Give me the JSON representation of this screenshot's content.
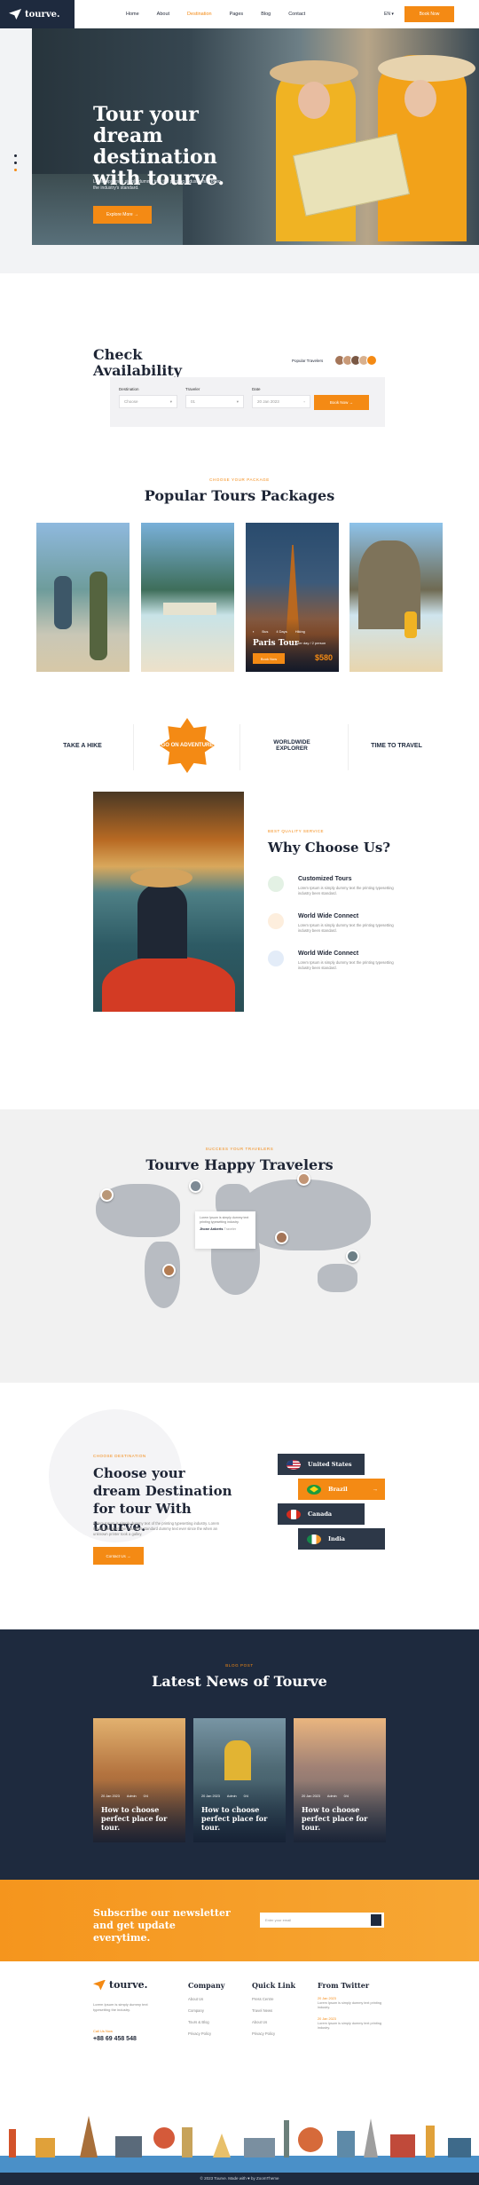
{
  "header": {
    "logo": "tourve.",
    "nav": [
      "Home",
      "About",
      "Destination",
      "Pages",
      "Blog",
      "Contact"
    ],
    "active_nav": "Destination",
    "language": "EN",
    "button": "Book Now"
  },
  "hero": {
    "title": "Tour your dream destination with tourve.",
    "text": "Lorem Ipsum is simply dummy text the printing industry has been the industry's standard.",
    "button": "Explore More"
  },
  "availability": {
    "title": "Check Availability",
    "popular_label": "Popular Travelers",
    "fields": [
      {
        "label": "Destination",
        "value": "Choose"
      },
      {
        "label": "Traveler",
        "value": "01"
      },
      {
        "label": "Date",
        "value": "20 Jan 2023"
      }
    ],
    "button": "Book Now"
  },
  "tours": {
    "subtitle": "CHOOSE YOUR PACKAGE",
    "title": "Popular Tours Packages",
    "featured": {
      "meta": [
        "Bus",
        "4 Days",
        "Hiking"
      ],
      "name": "Paris Tour",
      "duration": "per day / 2 person",
      "button": "Book Now",
      "price": "$580"
    }
  },
  "badges": [
    {
      "text": "TAKE A HIKE",
      "color": "#1e2a3e"
    },
    {
      "text": "GO ON ADVENTURE",
      "color": "#f48a14"
    },
    {
      "text": "WORLDWIDE EXPLORER",
      "color": "#1e2a3e"
    },
    {
      "text": "TIME TO TRAVEL",
      "color": "#1e2a3e"
    }
  ],
  "why": {
    "subtitle": "BEST QUALITY SERVICE",
    "title": "Why Choose Us?",
    "features": [
      {
        "title": "Customized Tours",
        "text": "Lorem Ipsum is simply dummy text the printing typesetting industry been standard.",
        "color": "#e3f1e4"
      },
      {
        "title": "World Wide Connect",
        "text": "Lorem Ipsum is simply dummy text the printing typesetting industry been standard.",
        "color": "#fdeedd"
      },
      {
        "title": "World Wide Connect",
        "text": "Lorem Ipsum is simply dummy text the printing typesetting industry been standard.",
        "color": "#e3ecf8"
      }
    ]
  },
  "travelers": {
    "subtitle": "SUCCESS YOUR TRAVELERS",
    "title": "Tourve Happy Travelers",
    "quote": "Lorem Ipsum is simply dummy text printing typesetting industry.",
    "author": "Jhone Anberts",
    "role": "Traveler"
  },
  "destination": {
    "subtitle": "CHOOSE DESTINATION",
    "title": "Choose your dream Destination for tour With tourve.",
    "text": "Lorem Ipsum is simply dummy text of the printing typesetting industry. Lorem Ipsum has been the industry's standard dummy text ever since the when an unknown printer took a galley.",
    "button": "Contact Us",
    "countries": [
      "United States",
      "Brazil",
      "Canada",
      "India"
    ],
    "active_country": "Brazil"
  },
  "news": {
    "subtitle": "BLOG POST",
    "title": "Latest News of Tourve",
    "posts": [
      {
        "date": "20 Jan 2023",
        "meta": "Admin",
        "comments": "0/4",
        "title": "How to choose perfect place for tour."
      },
      {
        "date": "20 Jan 2023",
        "meta": "Admin",
        "comments": "0/4",
        "title": "How to choose perfect place for tour."
      },
      {
        "date": "20 Jan 2023",
        "meta": "Admin",
        "comments": "0/4",
        "title": "How to choose perfect place for tour."
      }
    ]
  },
  "newsletter": {
    "title": "Subscribe our newsletter and get update everytime.",
    "placeholder": "Enter your email"
  },
  "footer": {
    "logo": "tourve.",
    "text": "Lorem Ipsum is simply dummy text typesetting the industry.",
    "call_label": "Call Us Now",
    "phone": "+88 69 458 548",
    "company": {
      "title": "Company",
      "links": [
        "About Us",
        "Company",
        "Tours & Blog",
        "Privacy Policy"
      ]
    },
    "quick": {
      "title": "Quick Link",
      "links": [
        "Press Centre",
        "Travel News",
        "About Us",
        "Privacy Policy"
      ]
    },
    "twitter": {
      "title": "From Twitter",
      "tweets": [
        {
          "date": "20 Jan 2023",
          "text": "Lorem Ipsum is simply dummy text printing industry."
        },
        {
          "date": "20 Jan 2023",
          "text": "Lorem Ipsum is simply dummy text printing industry."
        }
      ]
    },
    "copyright": "© 2023 Tourve. Made with ♥ by ZoomTheme"
  }
}
